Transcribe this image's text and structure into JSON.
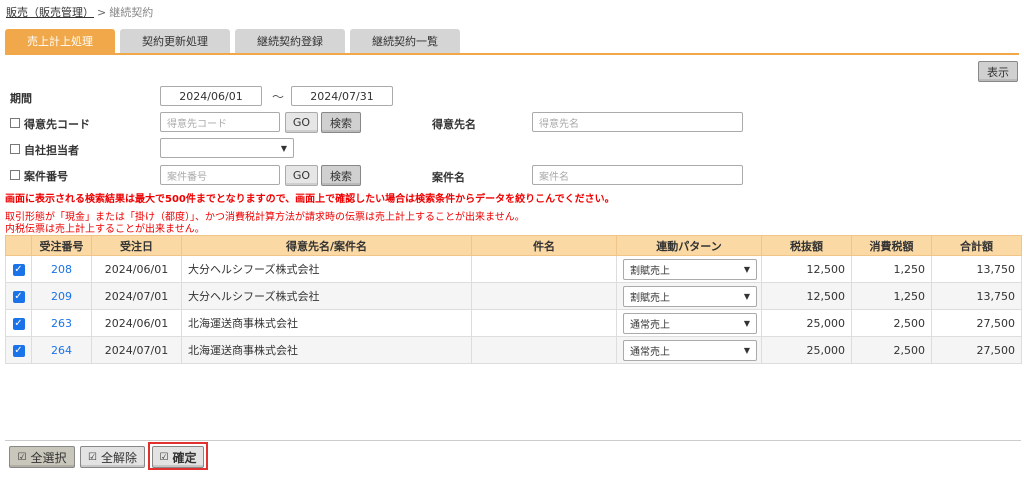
{
  "breadcrumb": {
    "parent": "販売（販売管理）",
    "separator": ">",
    "current": "継続契約"
  },
  "tabs": [
    "売上計上処理",
    "契約更新処理",
    "継続契約登録",
    "継続契約一覧"
  ],
  "active_tab": "売上計上処理",
  "toolbar": {
    "show_label": "表示"
  },
  "filters": {
    "period_label": "期間",
    "date_from": "2024/06/01",
    "date_sep": "～",
    "date_to": "2024/07/31",
    "customer_code_label": "得意先コード",
    "customer_code_placeholder": "得意先コード",
    "go_label": "GO",
    "search_label": "検索",
    "customer_name_label": "得意先名",
    "customer_name_placeholder": "得意先名",
    "staff_label": "自社担当者",
    "staff_value": "",
    "case_number_label": "案件番号",
    "case_number_placeholder": "案件番号",
    "case_name_label": "案件名",
    "case_name_placeholder": "案件名"
  },
  "messages": {
    "limit_warning": "画面に表示される検索結果は最大で500件までとなりますので、画面上で確認したい場合は検索条件からデータを絞りこんでください。",
    "note1": "取引形態が「現金」または「掛け（都度）」、かつ消費税計算方法が請求時の伝票は売上計上することが出来ません。",
    "note2": "内税伝票は売上計上することが出来ません。"
  },
  "table": {
    "headers": [
      "",
      "受注番号",
      "受注日",
      "得意先名/案件名",
      "件名",
      "連動パターン",
      "税抜額",
      "消費税額",
      "合計額"
    ],
    "rows": [
      {
        "checked": true,
        "order_no": "208",
        "date": "2024/06/01",
        "customer": "大分ヘルシフーズ株式会社",
        "subject": "",
        "pattern": "割賦売上",
        "excl_tax": "12,500",
        "tax": "1,250",
        "total": "13,750"
      },
      {
        "checked": true,
        "order_no": "209",
        "date": "2024/07/01",
        "customer": "大分ヘルシフーズ株式会社",
        "subject": "",
        "pattern": "割賦売上",
        "excl_tax": "12,500",
        "tax": "1,250",
        "total": "13,750"
      },
      {
        "checked": true,
        "order_no": "263",
        "date": "2024/06/01",
        "customer": "北海運送商事株式会社",
        "subject": "",
        "pattern": "通常売上",
        "excl_tax": "25,000",
        "tax": "2,500",
        "total": "27,500"
      },
      {
        "checked": true,
        "order_no": "264",
        "date": "2024/07/01",
        "customer": "北海運送商事株式会社",
        "subject": "",
        "pattern": "通常売上",
        "excl_tax": "25,000",
        "tax": "2,500",
        "total": "27,500"
      }
    ]
  },
  "footer": {
    "select_all": "全選択",
    "deselect_all": "全解除",
    "confirm": "確定"
  },
  "colors": {
    "accent": "#f0a84a",
    "header_bg": "#fbd9a4",
    "warning": "#e00000",
    "link": "#1a73e8",
    "confirm_border": "#e03030"
  }
}
